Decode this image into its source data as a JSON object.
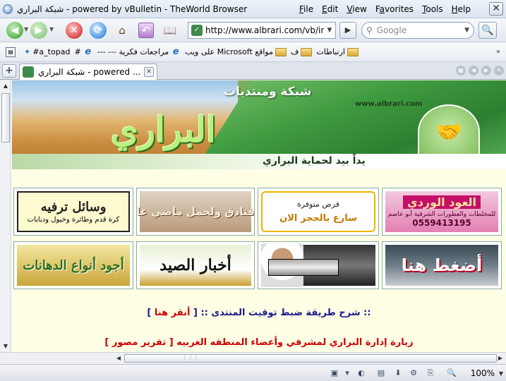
{
  "window": {
    "title": "شبكة البراري - powered by vBulletin - TheWorld Browser",
    "close_glyph": "✕"
  },
  "menu": {
    "items": [
      {
        "label": "File",
        "accel": "F",
        "rest": "ile"
      },
      {
        "label": "Edit",
        "accel": "E",
        "rest": "dit"
      },
      {
        "label": "View",
        "accel": "V",
        "rest": "iew"
      },
      {
        "label": "Favorites",
        "accel": "a",
        "pre": "F",
        "rest": "vorites"
      },
      {
        "label": "Tools",
        "accel": "T",
        "rest": "ools"
      },
      {
        "label": "Help",
        "accel": "H",
        "rest": "elp"
      }
    ]
  },
  "toolbar": {
    "address": "http://www.albrari.com/vb/in|",
    "search_placeholder": "Google"
  },
  "bookmarks": {
    "items": [
      {
        "label": "ارتباطات",
        "icon": "folder-icon"
      },
      {
        "label": "ف",
        "icon": "folder-icon"
      },
      {
        "label": "مواقع Microsoft على ويب",
        "icon": "folder-icon"
      },
      {
        "label": "مراجعات فكرية --- ---",
        "icon": "ie-icon"
      },
      {
        "label": "#",
        "icon": "ie-icon"
      },
      {
        "label": "#a_topad",
        "icon": "bookmark-icon"
      }
    ]
  },
  "tabs": {
    "active_label": "شبكة البراري - powered ..."
  },
  "banner": {
    "site_name": "البراري",
    "network_label": "شبكة ومنتديات",
    "url": "www.albrari.com",
    "tagline": "يداً بيد لحماية البراري"
  },
  "ads": {
    "ad1": {
      "title": "وسائل ترفيه",
      "subtitle": "كرة قدم وطائرة وخيول ودبابات"
    },
    "ad2": {
      "title": "فنادق ولحمل ماضي عا"
    },
    "ad3": {
      "line1": "فرص متوفرة",
      "line2": "سارع بالحجز الان"
    },
    "ad4": {
      "title": "العود الوردي",
      "subtitle": "للمخلطات والعطورات الشرقية أبو عاصم",
      "phone": "0559413195"
    },
    "ad5": {
      "title": "أجود أنواع الدهانات"
    },
    "ad6": {
      "title": "أخبار الصيد"
    },
    "ad7": {},
    "ad8": {
      "title": "أضغط هنا"
    }
  },
  "announcements": {
    "a1_text": ":: شرح طريقة ضبط توقيت المنتدى ::",
    "a1_link": "أنقر هنا",
    "a2_text": "زيارة إدارة البراري لمشرفي وأعضاء المنطقه الغربيه",
    "a2_link": "تقرير مصور"
  },
  "status": {
    "zoom": "100%"
  }
}
